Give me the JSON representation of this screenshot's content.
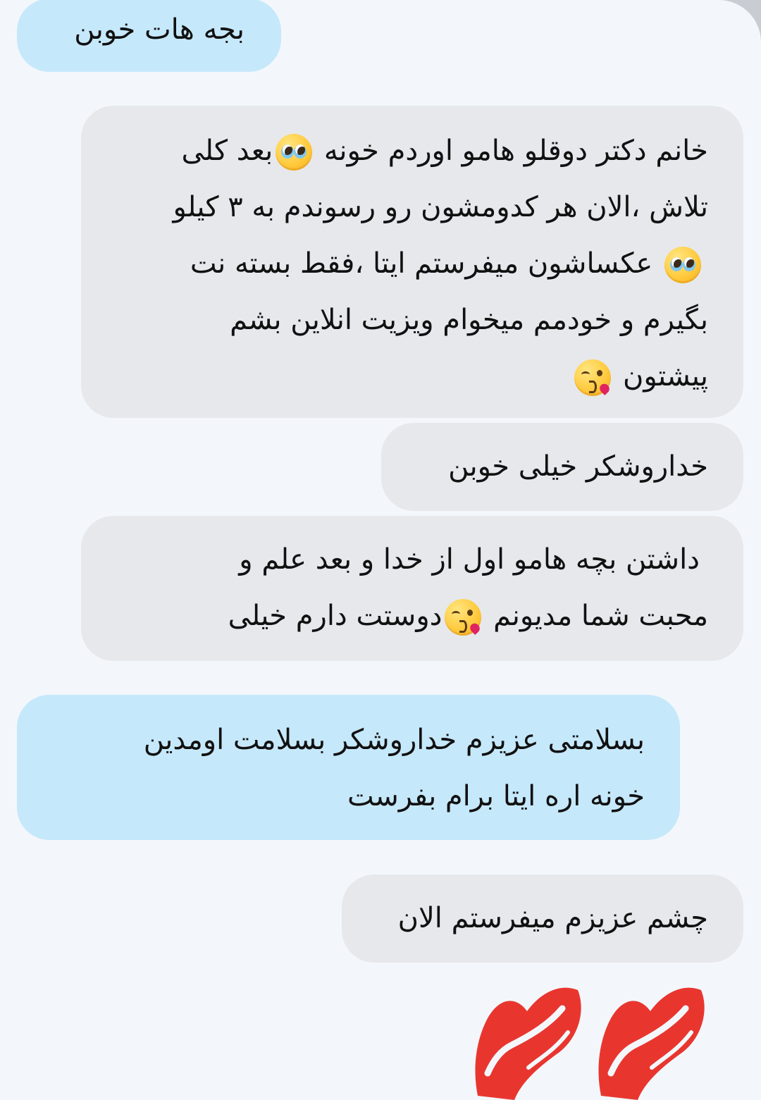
{
  "messages": [
    {
      "direction": "outgoing",
      "lines": [
        "بجه هات خوبن"
      ]
    },
    {
      "direction": "incoming",
      "lines": [
        {
          "before": "خانم دکتر دوقلو هامو اوردم خونه ",
          "emoji": "pleading-face-emoji",
          "after": "بعد کلی"
        },
        {
          "text": "تلاش ،الان هر کدومشون رو رسوندم به ۳ کیلو"
        },
        {
          "before": "",
          "emoji": "pleading-face-emoji",
          "after": " عکساشون میفرستم ایتا ،فقط بسته نت"
        },
        {
          "text": "بگیرم و خودمم میخوام ویزیت انلاین بشم"
        },
        {
          "before": "پیشتون ",
          "emoji": "kissing-heart-emoji",
          "after": ""
        }
      ]
    },
    {
      "direction": "incoming",
      "lines": [
        "خداروشکر خیلی خوبن"
      ]
    },
    {
      "direction": "incoming",
      "lines": [
        {
          "text": "داشتن بچه هامو اول از خدا و بعد علم  و"
        },
        {
          "before": "محبت شما مدیونم ",
          "emoji": "kissing-heart-emoji",
          "after": "دوستت دارم خیلی"
        }
      ]
    },
    {
      "direction": "outgoing",
      "lines": [
        "بسلامتی  عزیزم خداروشکر بسلامت اومدین",
        "خونه اره ایتا برام بفرست"
      ]
    },
    {
      "direction": "incoming",
      "lines": [
        "چشم عزیزم میفرستم الان"
      ]
    }
  ],
  "sticker": {
    "icon": "lips-kiss-icon",
    "count": 2,
    "color": "#e8362f"
  },
  "colors": {
    "background": "#f3f7fb",
    "incoming_bubble": "#e7e8ec",
    "outgoing_bubble": "#c6e8fb"
  }
}
